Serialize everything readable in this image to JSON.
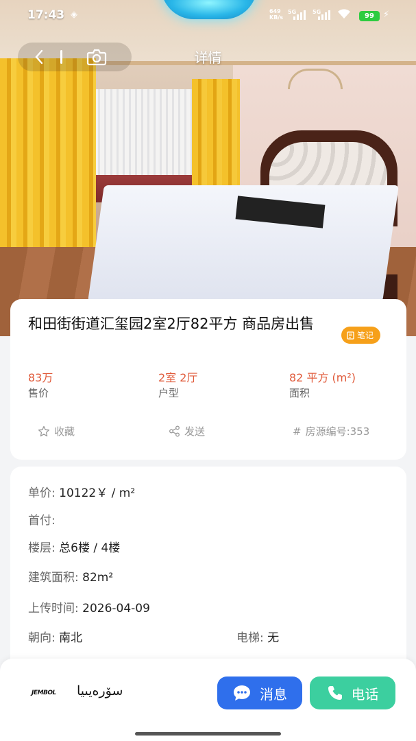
{
  "status_bar": {
    "time": "17:43",
    "net_speed_value": "649",
    "net_speed_unit": "KB/s",
    "sim1": "5G",
    "sim2": "5G",
    "battery": "99"
  },
  "nav": {
    "title": "详情"
  },
  "listing": {
    "title": "和田街街道汇玺园2室2厅82平方 商品房出售",
    "note_badge": "笔记",
    "stats": [
      {
        "value": "83万",
        "label": "售价"
      },
      {
        "value": "2室 2厅",
        "label": "户型"
      },
      {
        "value": "82 平方 (m²)",
        "label": "面积"
      }
    ],
    "actions": {
      "favorite": "收藏",
      "share": "发送",
      "listing_id_label": "房源编号:",
      "listing_id": "353"
    }
  },
  "details": {
    "unit_price_label": "单价:",
    "unit_price": "10122￥ / m²",
    "down_payment_label": "首付:",
    "down_payment": "",
    "floor_label": "楼层:",
    "floor": "总6楼 / 4楼",
    "area_label": "建筑面积:",
    "area": "82m²",
    "upload_label": "上传时间:",
    "upload": "2026-04-09",
    "orientation_label": "朝向:",
    "orientation": "南北",
    "elevator_label": "电梯:",
    "elevator": "无"
  },
  "footer": {
    "brand_logo": "JEMBOL",
    "brand_name": "سۆرەيىيا",
    "message_button": "消息",
    "call_button": "电话"
  },
  "colors": {
    "price_red": "#e05a3a",
    "badge_orange": "#f6a01a",
    "message_blue": "#2f6fec",
    "call_green": "#3ccf9f"
  }
}
